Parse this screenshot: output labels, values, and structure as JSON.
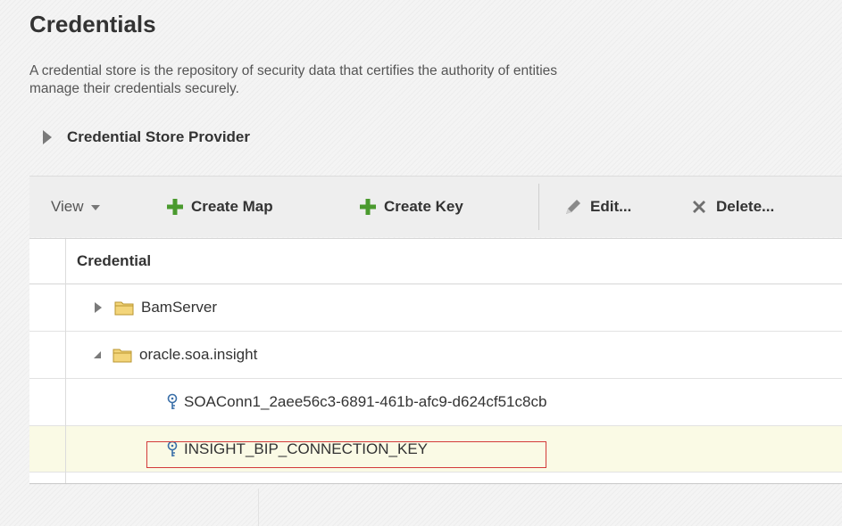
{
  "page": {
    "title": "Credentials",
    "description_line1": "A credential store is the repository of security data that certifies the authority of entities",
    "description_line2": "manage their credentials securely."
  },
  "provider": {
    "label": "Credential Store Provider",
    "icon": "disclosure-right-icon"
  },
  "toolbar": {
    "view_label": "View",
    "create_map_label": "Create Map",
    "create_key_label": "Create Key",
    "edit_label": "Edit...",
    "delete_label": "Delete..."
  },
  "table": {
    "column_header": "Credential",
    "rows": [
      {
        "label": "BamServer",
        "type": "map",
        "expanded": false
      },
      {
        "label": "oracle.soa.insight",
        "type": "map",
        "expanded": true
      },
      {
        "label": "SOAConn1_2aee56c3-6891-461b-afc9-d624cf51c8cb",
        "type": "key"
      },
      {
        "label": "INSIGHT_BIP_CONNECTION_KEY",
        "type": "key",
        "selected": true
      }
    ]
  },
  "colors": {
    "accent_green": "#4a9a2e",
    "delete_gray": "#6f6f6f",
    "folder_yellow": "#f3d57a",
    "highlight_red": "#d33a3a",
    "selected_row": "#fafae5"
  }
}
